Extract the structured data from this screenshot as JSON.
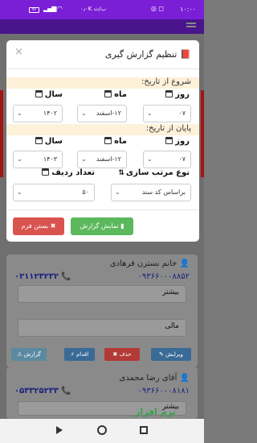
{
  "statusbar": {
    "time": "۱۰:۰۰",
    "net": "۰٫۰K ب/ث",
    "battery": "۷۶"
  },
  "modal": {
    "title": "تنظیم گزارش گیری",
    "from_section": "شروع از تاریخ:",
    "to_section": "پایان از تاریخ:",
    "labels": {
      "day": "روز",
      "month": "ماه",
      "year": "سال",
      "sort": "نوع مرتب سازی",
      "rows": "تعداد ردیف"
    },
    "from": {
      "day": "۰۷",
      "month": "۱۲-اسفند",
      "year": "۱۴۰۲"
    },
    "to": {
      "day": "۰۷",
      "month": "۱۲-اسفند",
      "year": "۱۴۰۳"
    },
    "sort_value": "براساس کد سند",
    "rows_value": "۵۰",
    "show_button": "نمایش گزارش",
    "close_button": "بستن فرم"
  },
  "background": {
    "card1": {
      "name": "خانم نسترن فرهادی",
      "phone1": "۰۲۱۱۲۳۲۳۲",
      "phone2": "۰۹۳۶۶۰۰۰۸۸۵۲",
      "box1": "بیشتر",
      "box2": "مالی",
      "btn_edit": "ویرایش",
      "btn_delete": "حذف",
      "btn_action": "اقدام",
      "btn_report": "گزارش"
    },
    "card2": {
      "name": "آقای رضا محمدی",
      "phone1": "۰۵۳۳۲۵۲۳۳",
      "phone2": "۰۹۳۶۶۰۰۰۸۱۸۱",
      "box1": "بیشتر"
    }
  },
  "watermark": "نرم افزار"
}
